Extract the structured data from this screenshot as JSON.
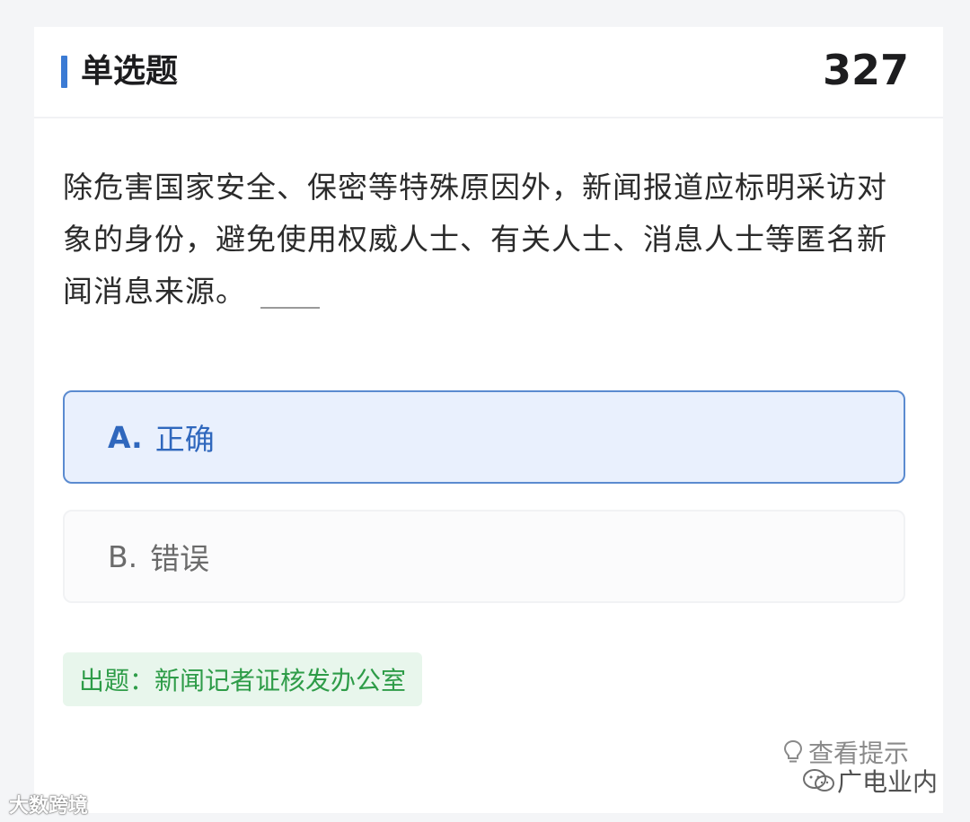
{
  "header": {
    "title": "单选题",
    "number": "327"
  },
  "question": {
    "text": "除危害国家安全、保密等特殊原因外，新闻报道应标明采访对象的身份，避免使用权威人士、有关人士、消息人士等匿名新闻消息来源。"
  },
  "options": [
    {
      "letter": "A.",
      "label": "正确",
      "selected": true
    },
    {
      "letter": "B.",
      "label": "错误",
      "selected": false
    }
  ],
  "source": {
    "text": "出题：新闻记者证核发办公室"
  },
  "hint": {
    "label": "查看提示",
    "icon": "lightbulb-icon"
  },
  "watermarks": {
    "right": "广电业内",
    "left": "大数跨境"
  },
  "colors": {
    "accent": "#3b7bd4",
    "selected_bg": "#e9f0fd",
    "selected_text": "#2f67bd",
    "source_bg": "#e8f6ec",
    "source_text": "#2e9c48"
  }
}
